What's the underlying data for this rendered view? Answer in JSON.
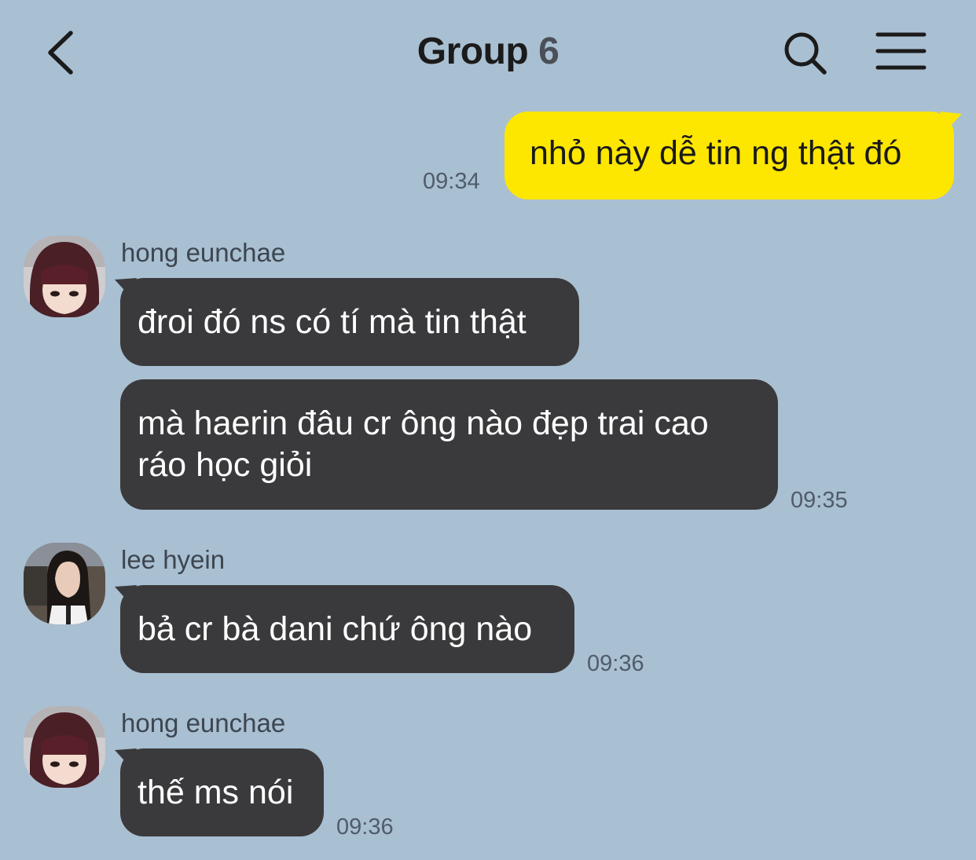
{
  "header": {
    "title": "Group",
    "member_count": "6",
    "back_icon": "chevron-left-icon",
    "search_icon": "search-icon",
    "menu_icon": "hamburger-menu-icon"
  },
  "colors": {
    "background": "#a9bfd2",
    "my_bubble": "#fde600",
    "other_bubble": "#3a3a3c"
  },
  "messages": [
    {
      "from": "me",
      "text": "nhỏ này dễ tin ng thật đó",
      "time": "09:34"
    },
    {
      "sender": "hong eunchae",
      "text": "đroi đó ns có tí mà tin thật"
    },
    {
      "sender": "hong eunchae",
      "text": "mà haerin đâu cr ông nào đẹp trai cao ráo học giỏi",
      "time": "09:35"
    },
    {
      "sender": "lee hyein",
      "text": "bả cr bà dani chứ ông nào",
      "time": "09:36"
    },
    {
      "sender": "hong eunchae",
      "text": "thế ms nói",
      "time": "09:36"
    }
  ]
}
